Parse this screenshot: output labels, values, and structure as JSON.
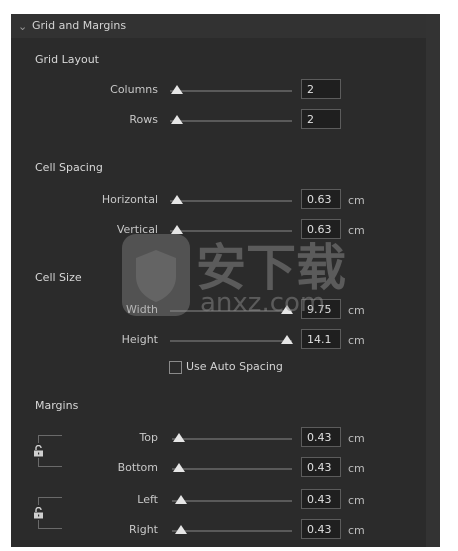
{
  "panel": {
    "title": "Grid and Margins"
  },
  "grid_layout": {
    "title": "Grid Layout",
    "columns": {
      "label": "Columns",
      "value": "2"
    },
    "rows": {
      "label": "Rows",
      "value": "2"
    }
  },
  "cell_spacing": {
    "title": "Cell Spacing",
    "horizontal": {
      "label": "Horizontal",
      "value": "0.63",
      "unit": "cm"
    },
    "vertical": {
      "label": "Vertical",
      "value": "0.63",
      "unit": "cm"
    }
  },
  "cell_size": {
    "title": "Cell Size",
    "width": {
      "label": "Width",
      "value": "9.75",
      "unit": "cm"
    },
    "height": {
      "label": "Height",
      "value": "14.1",
      "unit": "cm"
    },
    "auto_spacing_label": "Use Auto Spacing"
  },
  "margins": {
    "title": "Margins",
    "top": {
      "label": "Top",
      "value": "0.43",
      "unit": "cm"
    },
    "bottom": {
      "label": "Bottom",
      "value": "0.43",
      "unit": "cm"
    },
    "left": {
      "label": "Left",
      "value": "0.43",
      "unit": "cm"
    },
    "right": {
      "label": "Right",
      "value": "0.43",
      "unit": "cm"
    }
  },
  "watermark": {
    "text": "安下载",
    "subtext": "anxz.com"
  }
}
